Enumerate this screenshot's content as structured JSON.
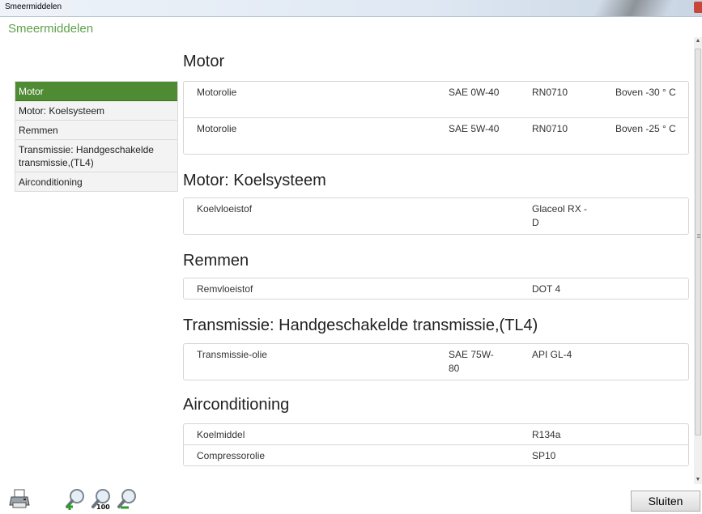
{
  "window": {
    "title": "Smeermiddelen"
  },
  "header": {
    "title": "Smeermiddelen"
  },
  "sidebar": {
    "items": [
      {
        "label": "Motor",
        "active": true
      },
      {
        "label": "Motor: Koelsysteem"
      },
      {
        "label": "Remmen"
      },
      {
        "label": "Transmissie: Handgeschakelde transmissie,(TL4)"
      },
      {
        "label": "Airconditioning"
      }
    ]
  },
  "sections": [
    {
      "title": "Motor",
      "rows": [
        {
          "name": "Motorolie",
          "spec": "SAE 0W-40",
          "code": "RN0710",
          "temp": "Boven -30 ° C"
        },
        {
          "name": "Motorolie",
          "spec": "SAE 5W-40",
          "code": "RN0710",
          "temp": "Boven -25 ° C"
        }
      ]
    },
    {
      "title": "Motor: Koelsysteem",
      "rows": [
        {
          "name": "Koelvloeistof",
          "spec": "",
          "code": "Glaceol RX -D",
          "temp": ""
        }
      ]
    },
    {
      "title": "Remmen",
      "rows": [
        {
          "name": "Remvloeistof",
          "spec": "",
          "code": "DOT 4",
          "temp": ""
        }
      ]
    },
    {
      "title": "Transmissie: Handgeschakelde transmissie,(TL4)",
      "rows": [
        {
          "name": "Transmissie-olie",
          "spec": "SAE 75W-80",
          "code": "API GL-4",
          "temp": ""
        }
      ]
    },
    {
      "title": "Airconditioning",
      "rows": [
        {
          "name": "Koelmiddel",
          "spec": "",
          "code": "R134a",
          "temp": ""
        },
        {
          "name": "Compressorolie",
          "spec": "",
          "code": "SP10",
          "temp": ""
        }
      ]
    }
  ],
  "toolbar": {
    "icons": [
      "print-icon",
      "zoom-in-icon",
      "zoom-100-icon",
      "zoom-out-icon"
    ],
    "zoom_100_label": "100",
    "close_label": "Sluiten"
  },
  "colors": {
    "accent": "#4f8b32",
    "header_text": "#5ea04a"
  }
}
